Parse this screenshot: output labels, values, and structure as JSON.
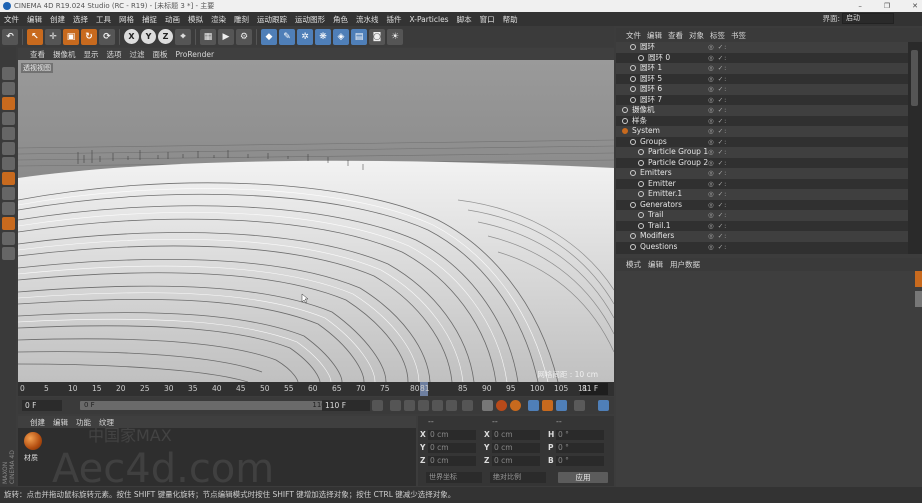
{
  "titlebar": {
    "title": "CINEMA 4D R19.024 Studio (RC - R19) - [未标题 3 *] - 主要",
    "minimize": "–",
    "restore": "❐",
    "close": "✕"
  },
  "menubar": {
    "items": [
      "文件",
      "编辑",
      "创建",
      "选择",
      "工具",
      "网格",
      "捕捉",
      "动画",
      "模拟",
      "渲染",
      "雕刻",
      "运动跟踪",
      "运动图形",
      "角色",
      "流水线",
      "插件",
      "X-Particles",
      "脚本",
      "窗口",
      "帮助"
    ],
    "layout_label": "界面:",
    "layout_value": "启动"
  },
  "toolbar": {
    "icons": [
      "undo-icon",
      "pointer-icon",
      "move-icon",
      "scale-icon",
      "rotate-icon",
      "recent-icon",
      "x-axis-icon",
      "y-axis-icon",
      "z-axis-icon",
      "coord-system-icon",
      "render-region-icon",
      "render-view-icon",
      "render-settings-icon",
      "cube-icon",
      "pen-icon",
      "subdivision-icon",
      "array-icon",
      "deformer-icon",
      "floor-icon",
      "camera-icon",
      "light-icon"
    ],
    "x": "X",
    "y": "Y",
    "z": "Z"
  },
  "viewport": {
    "menu": [
      "查看",
      "摄像机",
      "显示",
      "选项",
      "过滤",
      "面板",
      "ProRender"
    ],
    "label": "透视视图",
    "grid_spacing": "网格间距 : 10 cm"
  },
  "timeline": {
    "ticks": [
      "0",
      "5",
      "10",
      "15",
      "20",
      "25",
      "30",
      "35",
      "40",
      "45",
      "50",
      "55",
      "60",
      "65",
      "70",
      "75",
      "80",
      "81",
      "85",
      "90",
      "95",
      "100",
      "105",
      "11"
    ],
    "current_frame": "81 F"
  },
  "transport": {
    "start_frame": "0 F",
    "slider_start": "0 F",
    "slider_end": "110 F",
    "end_frame": "110 F"
  },
  "material": {
    "menu": [
      "创建",
      "编辑",
      "功能",
      "纹理"
    ],
    "ball_label": "材质",
    "watermark_top": "中国家MAX",
    "watermark": "Aec4d.com"
  },
  "coordinates": {
    "header_a": "--",
    "header_b": "--",
    "header_c": "--",
    "rows": [
      {
        "a": "X",
        "av": "0 cm",
        "b": "X",
        "bv": "0 cm",
        "c": "H",
        "cv": "0 °"
      },
      {
        "a": "Y",
        "av": "0 cm",
        "b": "Y",
        "bv": "0 cm",
        "c": "P",
        "cv": "0 °"
      },
      {
        "a": "Z",
        "av": "0 cm",
        "b": "Z",
        "bv": "0 cm",
        "c": "B",
        "cv": "0 °"
      }
    ],
    "coord_mode": "世界坐标",
    "size_mode": "绝对比例",
    "apply": "应用"
  },
  "object_manager": {
    "menu": [
      "文件",
      "编辑",
      "查看",
      "对象",
      "标签",
      "书签"
    ],
    "rows": [
      {
        "name": "圆环",
        "indent": 1
      },
      {
        "name": "圆环 0",
        "indent": 2
      },
      {
        "name": "圆环 1",
        "indent": 1
      },
      {
        "name": "圆环 5",
        "indent": 1
      },
      {
        "name": "圆环 6",
        "indent": 1
      },
      {
        "name": "圆环 7",
        "indent": 1
      },
      {
        "name": "摄像机",
        "indent": 0
      },
      {
        "name": "样条",
        "indent": 0
      },
      {
        "name": "System",
        "indent": 0
      },
      {
        "name": "Groups",
        "indent": 1
      },
      {
        "name": "Particle Group 1",
        "indent": 2
      },
      {
        "name": "Particle Group 2",
        "indent": 2
      },
      {
        "name": "Emitters",
        "indent": 1
      },
      {
        "name": "Emitter",
        "indent": 2
      },
      {
        "name": "Emitter.1",
        "indent": 2
      },
      {
        "name": "Generators",
        "indent": 1
      },
      {
        "name": "Trail",
        "indent": 2
      },
      {
        "name": "Trail.1",
        "indent": 2
      },
      {
        "name": "Modifiers",
        "indent": 1
      },
      {
        "name": "Questions",
        "indent": 1
      }
    ],
    "flags": "◎ ✓:"
  },
  "attribute_manager": {
    "menu": [
      "模式",
      "编辑",
      "用户数据"
    ]
  },
  "statusbar": {
    "text": "旋转：点击并拖动鼠标旋转元素。按住 SHIFT 键量化旋转；节点编辑模式时按住 SHIFT 键增加选择对象；按住 CTRL 键减少选择对象。"
  },
  "side_brand": "MAXON CINEMA 4D"
}
